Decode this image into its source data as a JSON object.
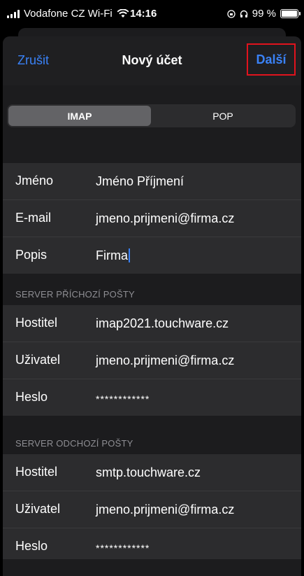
{
  "status_bar": {
    "carrier": "Vodafone CZ Wi-Fi",
    "time": "14:16",
    "battery": "99 %"
  },
  "nav": {
    "cancel_label": "Zrušit",
    "title": "Nový účet",
    "next_label": "Další"
  },
  "segment": {
    "options": [
      "IMAP",
      "POP"
    ],
    "selected": "IMAP"
  },
  "account": [
    {
      "label": "Jméno",
      "value": "Jméno Příjmení"
    },
    {
      "label": "E-mail",
      "value": "jmeno.prijmeni@firma.cz"
    },
    {
      "label": "Popis",
      "value": "Firma"
    }
  ],
  "incoming": {
    "title": "SERVER PŘÍCHOZÍ POŠTY",
    "rows": [
      {
        "label": "Hostitel",
        "value": "imap2021.touchware.cz"
      },
      {
        "label": "Uživatel",
        "value": "jmeno.prijmeni@firma.cz"
      },
      {
        "label": "Heslo",
        "value": "************"
      }
    ]
  },
  "outgoing": {
    "title": "SERVER ODCHOZÍ POŠTY",
    "rows": [
      {
        "label": "Hostitel",
        "value": "smtp.touchware.cz"
      },
      {
        "label": "Uživatel",
        "value": "jmeno.prijmeni@firma.cz"
      },
      {
        "label": "Heslo",
        "value": "************"
      }
    ]
  },
  "colors": {
    "accent": "#3a82f7",
    "highlight_border": "#e1131d"
  }
}
